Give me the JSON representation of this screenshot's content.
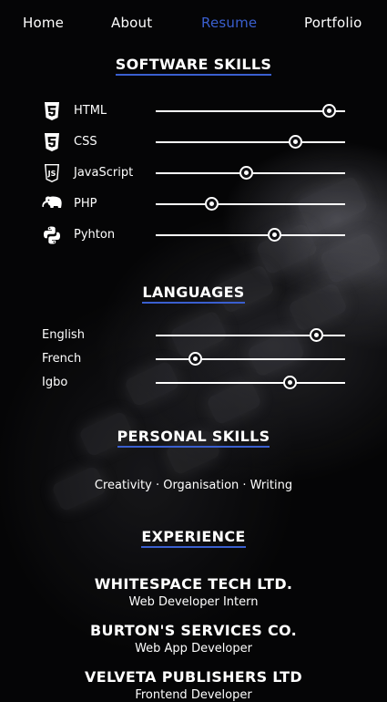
{
  "nav": {
    "items": [
      {
        "label": "Home",
        "active": false
      },
      {
        "label": "About",
        "active": false
      },
      {
        "label": "Resume",
        "active": true
      },
      {
        "label": "Portfolio",
        "active": false
      }
    ]
  },
  "software_skills": {
    "title": "SOFTWARE SKILLS",
    "items": [
      {
        "label": "HTML",
        "icon": "html5-icon",
        "level": 0.92
      },
      {
        "label": "CSS",
        "icon": "css3-icon",
        "level": 0.74
      },
      {
        "label": "JavaScript",
        "icon": "javascript-icon",
        "level": 0.48
      },
      {
        "label": "PHP",
        "icon": "php-elephant-icon",
        "level": 0.3
      },
      {
        "label": "Pyhton",
        "icon": "python-icon",
        "level": 0.63
      }
    ]
  },
  "languages": {
    "title": "LANGUAGES",
    "items": [
      {
        "label": "English",
        "level": 0.85
      },
      {
        "label": "French",
        "level": 0.21
      },
      {
        "label": "Igbo",
        "level": 0.71
      }
    ]
  },
  "personal_skills": {
    "title": "PERSONAL SKILLS",
    "text": "Creativity · Organisation · Writing"
  },
  "experience": {
    "title": "EXPERIENCE",
    "items": [
      {
        "company": "WHITESPACE TECH LTD.",
        "role": "Web Developer Intern"
      },
      {
        "company": "BURTON'S SERVICES CO.",
        "role": "Web App Developer"
      },
      {
        "company": "VELVETA PUBLISHERS LTD",
        "role": "Frontend Developer"
      }
    ]
  },
  "colors": {
    "accent": "#3a5fcf",
    "background": "#050506",
    "text": "#ffffff"
  }
}
